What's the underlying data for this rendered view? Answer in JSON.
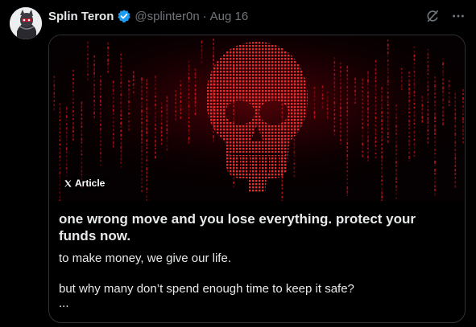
{
  "author": {
    "name": "Splin Teron",
    "handle": "@splinter0n",
    "separator": "·",
    "date": "Aug 16"
  },
  "icons": {
    "verified": "verified-badge-icon",
    "grok": "grok-icon",
    "more": "more-icon",
    "x_logo": "x-logo-icon"
  },
  "colors": {
    "verified": "#1d9bf0",
    "muted": "#71767b",
    "matrix_red": "#e0141f"
  },
  "article": {
    "badge_label": "Article",
    "title": "one wrong move and you lose everything. protect your funds now.",
    "paragraph_1": "to make money, we give our life.",
    "paragraph_2": "but why many don’t spend enough time to keep it safe?",
    "ellipsis": "..."
  }
}
